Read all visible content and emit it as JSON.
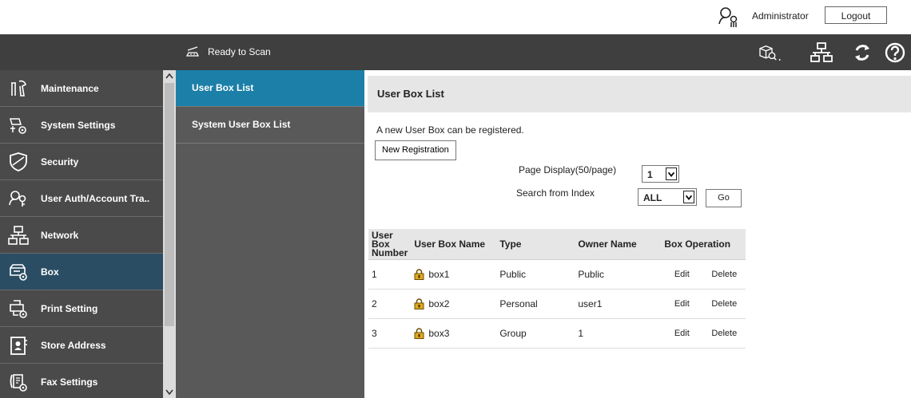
{
  "user": {
    "name": "Administrator",
    "logout_label": "Logout"
  },
  "header": {
    "status": "Ready to Scan",
    "icons": [
      "device-search-icon",
      "network-icon",
      "refresh-icon",
      "help-icon"
    ]
  },
  "sidebar": {
    "items": [
      {
        "label": "Maintenance",
        "icon": "maintenance-icon"
      },
      {
        "label": "System Settings",
        "icon": "system-settings-icon"
      },
      {
        "label": "Security",
        "icon": "shield-icon"
      },
      {
        "label": "User Auth/Account Tra..",
        "icon": "user-auth-icon"
      },
      {
        "label": "Network",
        "icon": "network-icon"
      },
      {
        "label": "Box",
        "icon": "box-icon",
        "active": true
      },
      {
        "label": "Print Setting",
        "icon": "print-setting-icon"
      },
      {
        "label": "Store Address",
        "icon": "store-address-icon"
      },
      {
        "label": "Fax Settings",
        "icon": "fax-settings-icon"
      }
    ]
  },
  "submenu": {
    "items": [
      {
        "label": "User Box List",
        "active": true
      },
      {
        "label": "System User Box List"
      }
    ]
  },
  "main": {
    "title": "User Box List",
    "intro": "A new User Box can be registered.",
    "new_registration_label": "New Registration",
    "page_display_label": "Page Display(50/page)",
    "page_value": "1",
    "search_label": "Search from Index",
    "index_value": "ALL",
    "go_label": "Go"
  },
  "table": {
    "headers": {
      "number": [
        "User",
        "Box",
        "Number"
      ],
      "name": "User Box Name",
      "type": "Type",
      "owner": "Owner Name",
      "operation": "Box Operation"
    },
    "rows": [
      {
        "number": "1",
        "name": "box1",
        "type": "Public",
        "owner": "Public",
        "edit": "Edit",
        "delete": "Delete"
      },
      {
        "number": "2",
        "name": "box2",
        "type": "Personal",
        "owner": "user1",
        "edit": "Edit",
        "delete": "Delete"
      },
      {
        "number": "3",
        "name": "box3",
        "type": "Group",
        "owner": "1",
        "edit": "Edit",
        "delete": "Delete"
      }
    ]
  },
  "colors": {
    "header_bg": "#3f3f3f",
    "sidebar_bg": "#4a4a4a",
    "sidebar_active": "#2a4d63",
    "submenu_bg": "#595959",
    "submenu_active": "#1c7fa8",
    "title_bg": "#e6e6e6",
    "lock": "#d4a017"
  }
}
